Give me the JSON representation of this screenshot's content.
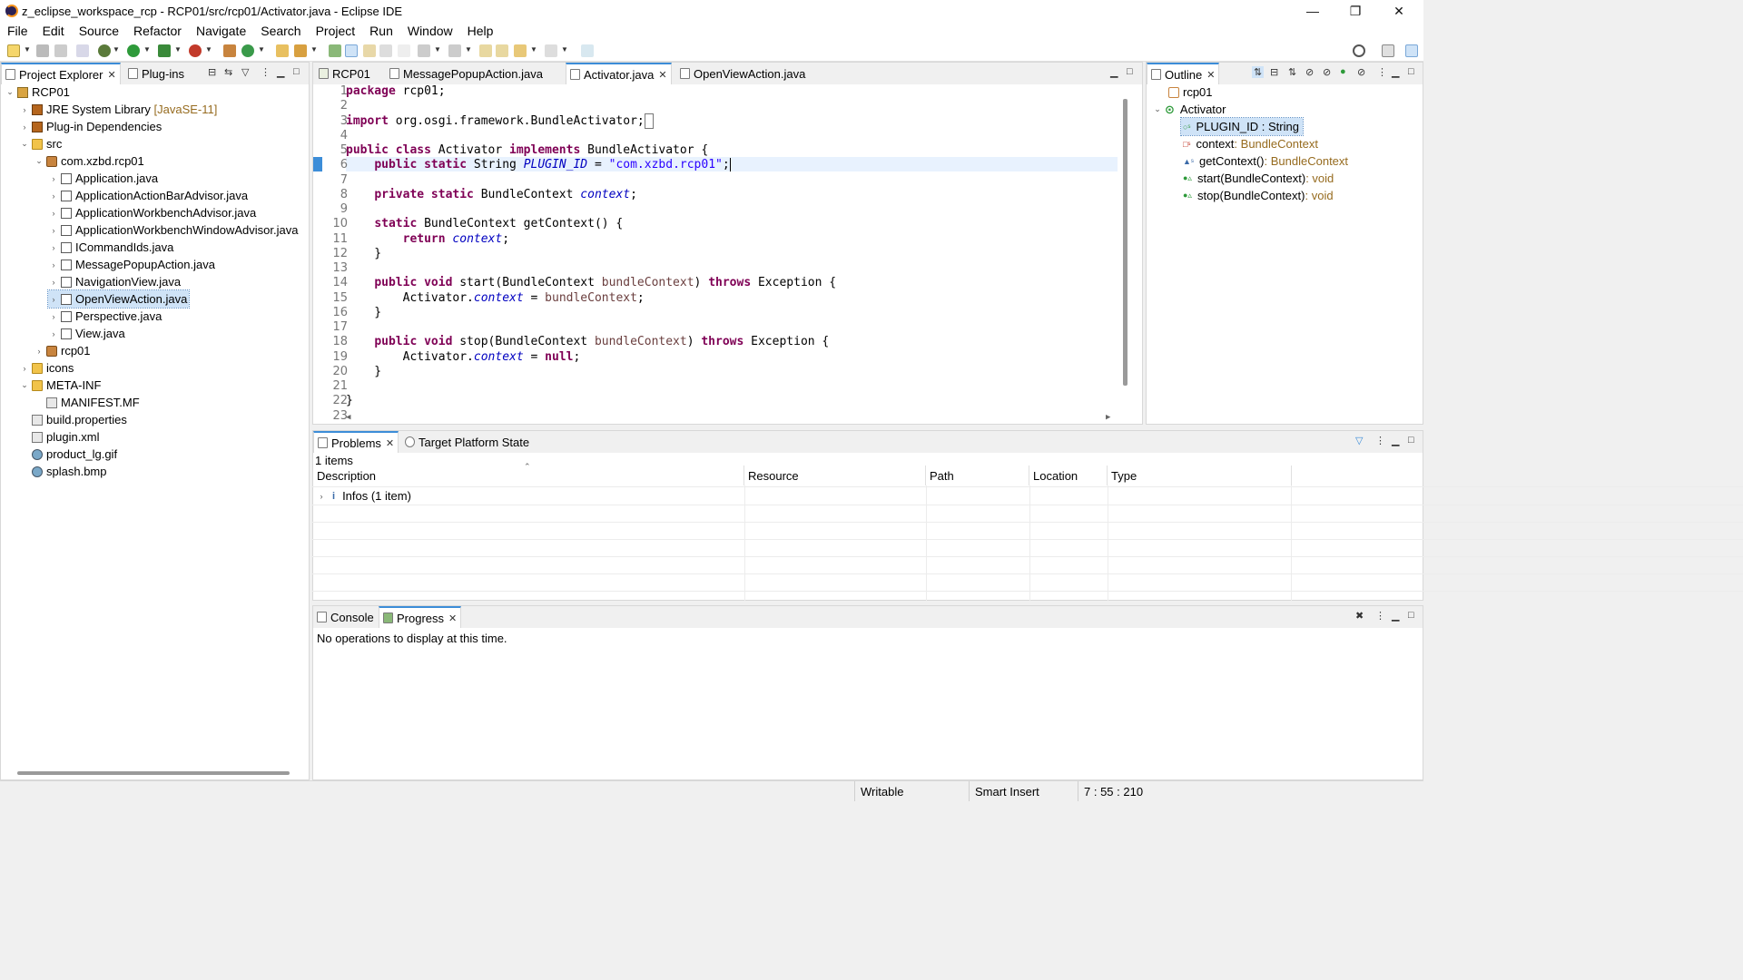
{
  "window": {
    "title": "z_eclipse_workspace_rcp - RCP01/src/rcp01/Activator.java - Eclipse IDE",
    "controls": {
      "minimize": "—",
      "restore": "❐",
      "close": "✕"
    }
  },
  "menu": [
    "File",
    "Edit",
    "Source",
    "Refactor",
    "Navigate",
    "Search",
    "Project",
    "Run",
    "Window",
    "Help"
  ],
  "left_panel": {
    "tabs": [
      {
        "label": "Project Explorer"
      },
      {
        "label": "Plug-ins"
      }
    ],
    "tree": [
      {
        "label": "RCP01",
        "icon": "project-icon"
      },
      {
        "label": "JRE System Library",
        "extra": "[JavaSE-11]",
        "icon": "library-icon"
      },
      {
        "label": "Plug-in Dependencies",
        "icon": "library-icon"
      },
      {
        "label": "src",
        "icon": "folder-icon"
      },
      {
        "label": "com.xzbd.rcp01",
        "icon": "package-icon"
      },
      {
        "label": "Application.java",
        "icon": "java-file-icon"
      },
      {
        "label": "ApplicationActionBarAdvisor.java",
        "icon": "java-file-icon"
      },
      {
        "label": "ApplicationWorkbenchAdvisor.java",
        "icon": "java-file-icon"
      },
      {
        "label": "ApplicationWorkbenchWindowAdvisor.java",
        "icon": "java-file-icon"
      },
      {
        "label": "ICommandIds.java",
        "icon": "java-file-icon"
      },
      {
        "label": "MessagePopupAction.java",
        "icon": "java-file-icon"
      },
      {
        "label": "NavigationView.java",
        "icon": "java-file-icon"
      },
      {
        "label": "OpenViewAction.java",
        "icon": "java-file-icon"
      },
      {
        "label": "Perspective.java",
        "icon": "java-file-icon"
      },
      {
        "label": "View.java",
        "icon": "java-file-icon"
      },
      {
        "label": "rcp01",
        "icon": "package-icon"
      },
      {
        "label": "icons",
        "icon": "folder-icon"
      },
      {
        "label": "META-INF",
        "icon": "folder-icon"
      },
      {
        "label": "MANIFEST.MF",
        "icon": "manifest-icon"
      },
      {
        "label": "build.properties",
        "icon": "properties-icon"
      },
      {
        "label": "plugin.xml",
        "icon": "xml-icon"
      },
      {
        "label": "product_lg.gif",
        "icon": "image-icon"
      },
      {
        "label": "splash.bmp",
        "icon": "image-icon"
      }
    ]
  },
  "editor": {
    "tabs": [
      {
        "label": "RCP01"
      },
      {
        "label": "MessagePopupAction.java"
      },
      {
        "label": "Activator.java"
      },
      {
        "label": "OpenViewAction.java"
      }
    ],
    "line_numbers": [
      "1",
      "2",
      "3",
      "4",
      "5",
      "6",
      "7",
      "8",
      "9",
      "10",
      "11",
      "12",
      "13",
      "14",
      "15",
      "16",
      "17",
      "18",
      "19",
      "20",
      "21",
      "22",
      "23"
    ]
  },
  "outline": {
    "tab": "Outline",
    "items": [
      {
        "label": "rcp01",
        "type": ""
      },
      {
        "label": "Activator",
        "type": ""
      },
      {
        "label": "PLUGIN_ID : String",
        "type": ""
      },
      {
        "label": "context",
        "type": " : BundleContext"
      },
      {
        "label": "getContext()",
        "type": " : BundleContext"
      },
      {
        "label": "start(BundleContext)",
        "type": " : void"
      },
      {
        "label": "stop(BundleContext)",
        "type": " : void"
      }
    ]
  },
  "problems": {
    "tabs": [
      {
        "label": "Problems"
      },
      {
        "label": "Target Platform State"
      }
    ],
    "count": "1 items",
    "columns": [
      "Description",
      "Resource",
      "Path",
      "Location",
      "Type"
    ],
    "rows": [
      {
        "description": "Infos (1 item)"
      }
    ]
  },
  "console": {
    "tabs": [
      {
        "label": "Console"
      },
      {
        "label": "Progress"
      }
    ],
    "message": "No operations to display at this time."
  },
  "status": {
    "writable": "Writable",
    "insert_mode": "Smart Insert",
    "position": "7 : 55 : 210"
  },
  "colors": {
    "accent": "#3c8dd8",
    "keyword": "#7f0055",
    "field": "#0000c0",
    "string": "#2a00ff"
  }
}
